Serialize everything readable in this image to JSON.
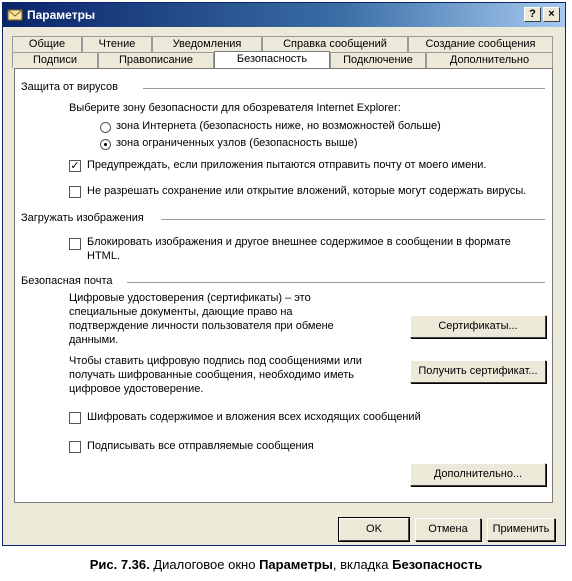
{
  "window": {
    "title": "Параметры",
    "help_label": "?",
    "close_label": "×"
  },
  "tabs_row1": [
    "Общие",
    "Чтение",
    "Уведомления",
    "Справка сообщений",
    "Создание сообщения"
  ],
  "tabs_row2": [
    "Подписи",
    "Правописание",
    "Безопасность",
    "Подключение",
    "Дополнительно"
  ],
  "virus": {
    "title": "Защита от вирусов",
    "zone_prompt": "Выберите зону безопасности для обозревателя Internet Explorer:",
    "zone_internet": "зона Интернета (безопасность ниже, но возможностей больше)",
    "zone_restricted": "зона ограниченных узлов (безопасность выше)",
    "selected_zone": "restricted",
    "warn_mail": "Предупреждать, если приложения пытаются отправить почту от моего имени.",
    "warn_mail_checked": true,
    "block_attach": "Не разрешать сохранение или открытие вложений, которые могут содержать вирусы.",
    "block_attach_checked": false
  },
  "images": {
    "title": "Загружать изображения",
    "block_images": "Блокировать изображения и другое внешнее содержимое в сообщении в формате HTML.",
    "block_images_checked": false
  },
  "secure": {
    "title": "Безопасная почта",
    "certs_text": "Цифровые удостоверения (сертификаты) – это специальные документы, дающие право на подтверждение личности пользователя при обмене данными.",
    "certs_button": "Сертификаты...",
    "sign_text": "Чтобы ставить цифровую подпись под сообщениями или получать шифрованные сообщения, необходимо иметь цифровое удостоверение.",
    "get_cert_button": "Получить сертификат...",
    "encrypt": "Шифровать содержимое и вложения всех исходящих сообщений",
    "encrypt_checked": false,
    "sign_all": "Подписывать все отправляемые сообщения",
    "sign_all_checked": false,
    "advanced_button": "Дополнительно..."
  },
  "footer": {
    "ok": "OK",
    "cancel": "Отмена",
    "apply": "Применить"
  },
  "caption": {
    "prefix": "Рис. 7.36.",
    "middle1": " Диалоговое окно ",
    "bold1": "Параметры",
    "middle2": ", вкладка ",
    "bold2": "Безопасность"
  }
}
